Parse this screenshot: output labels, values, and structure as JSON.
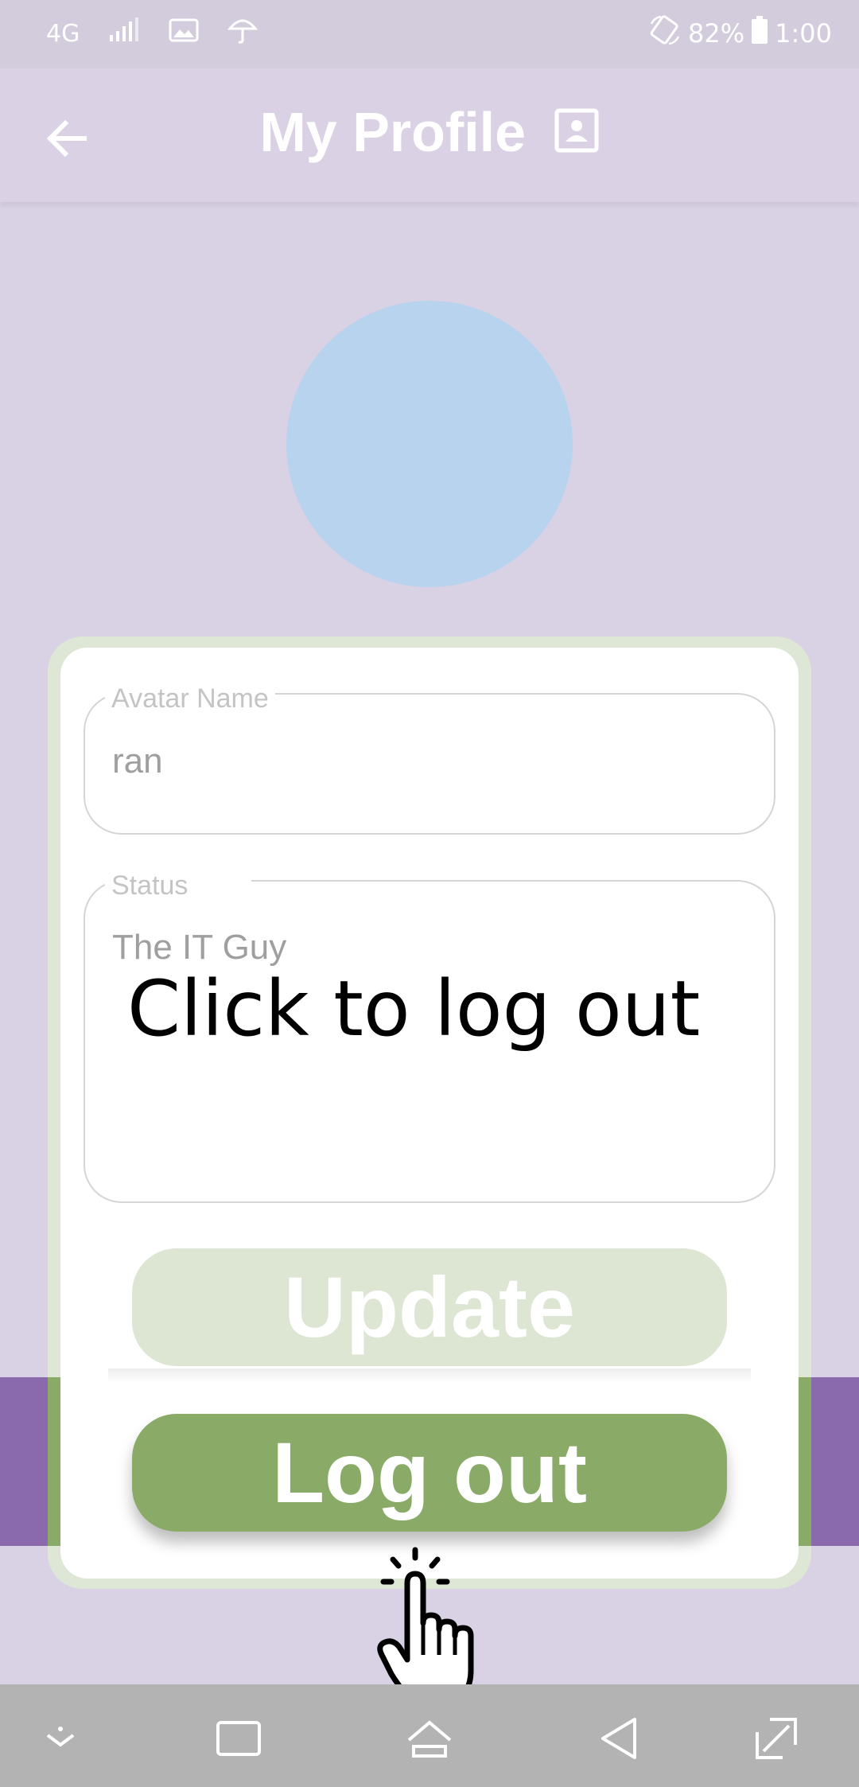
{
  "status_bar": {
    "network": "4G",
    "battery": "82%",
    "time": "1:00",
    "icons": [
      "signal-icon",
      "gallery-icon",
      "umbrella-icon",
      "rotate-icon",
      "battery-icon"
    ]
  },
  "header": {
    "title": "My Profile",
    "back_icon": "arrow-left-icon",
    "title_icon": "contact-card-icon"
  },
  "form": {
    "avatar_name": {
      "label": "Avatar Name",
      "value": "ran"
    },
    "status": {
      "label": "Status",
      "value": "The IT Guy"
    }
  },
  "overlay_hint": "Click to log out",
  "buttons": {
    "update": "Update",
    "logout": "Log out"
  },
  "nav_bar": {
    "icons": [
      "dropdown-icon",
      "recents-icon",
      "home-icon",
      "back-icon",
      "expand-icon"
    ]
  },
  "colors": {
    "background": "#d9d1e4",
    "avatar": "#b8d3ee",
    "accent_green": "#8aab67",
    "disabled_green": "#dde5d3",
    "band_purple": "#8a69ad",
    "nav_bar": "#b3b3b3"
  }
}
